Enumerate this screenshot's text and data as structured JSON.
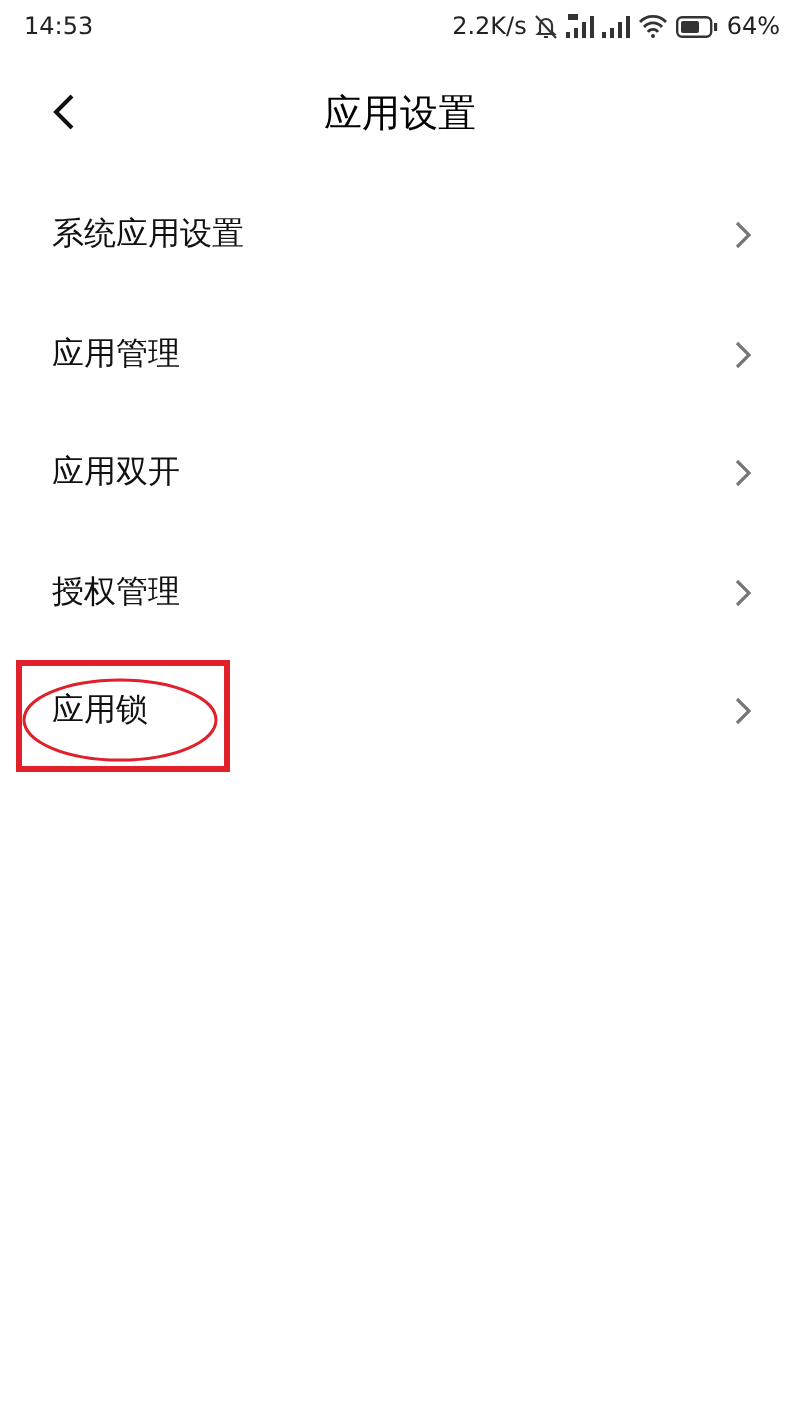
{
  "status_bar": {
    "time": "14:53",
    "speed": "2.2K/s",
    "battery": "64%"
  },
  "header": {
    "title": "应用设置"
  },
  "items": [
    {
      "label": "系统应用设置",
      "annotated": false
    },
    {
      "label": "应用管理",
      "annotated": false
    },
    {
      "label": "应用双开",
      "annotated": false
    },
    {
      "label": "授权管理",
      "annotated": false
    },
    {
      "label": "应用锁",
      "annotated": true
    }
  ]
}
